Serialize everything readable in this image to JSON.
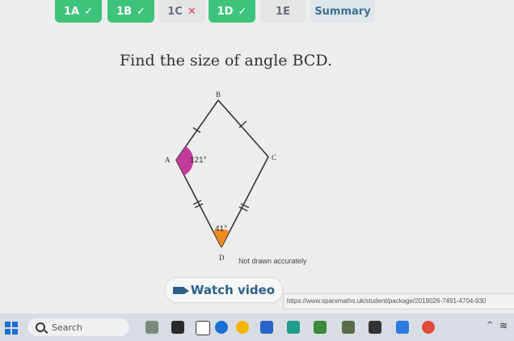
{
  "tabs": [
    {
      "label": "1A",
      "status": "correct",
      "mark": "✓"
    },
    {
      "label": "1B",
      "status": "correct",
      "mark": "✓"
    },
    {
      "label": "1C",
      "status": "wrong",
      "mark": "✕"
    },
    {
      "label": "1D",
      "status": "correct",
      "mark": "✓"
    },
    {
      "label": "1E",
      "status": "plain",
      "mark": ""
    },
    {
      "label": "Summary",
      "status": "summary",
      "mark": ""
    }
  ],
  "question": "Find the size of angle BCD.",
  "diagram": {
    "vertex_labels": {
      "A": "A",
      "B": "B",
      "C": "C",
      "D": "D"
    },
    "angle_A": "121°",
    "angle_D": "41°",
    "colors": {
      "angle_A": "#c23a9a",
      "angle_D": "#f08a24"
    }
  },
  "note": "Not drawn accurately",
  "watch_video": "Watch video",
  "url": "https://www.sparxmaths.uk/student/package/2019026-7491-4704-930",
  "taskbar": {
    "search_placeholder": "Search"
  }
}
